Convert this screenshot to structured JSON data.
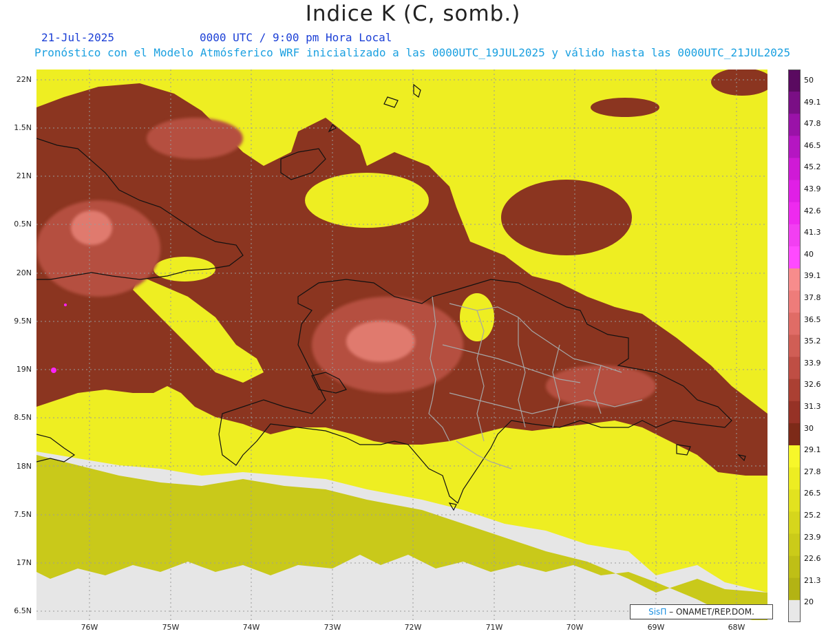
{
  "title": "Indice K (C, somb.)",
  "date": "21-Jul-2025",
  "time": "0000 UTC / 9:00 pm Hora Local",
  "description": "Pronóstico con el Modelo Atmósferico WRF inicializado a las 0000UTC_19JUL2025 y válido hasta las  0000UTC_21JUL2025",
  "lat_labels": [
    "22N",
    "1.5N",
    "21N",
    "0.5N",
    "20N",
    "9.5N",
    "19N",
    "8.5N",
    "18N",
    "7.5N",
    "17N",
    "6.5N"
  ],
  "lon_labels": [
    "76W",
    "75W",
    "74W",
    "73W",
    "72W",
    "71W",
    "70W",
    "69W",
    "68W"
  ],
  "colorbar": {
    "labels": [
      "50",
      "49.1",
      "47.8",
      "46.5",
      "45.2",
      "43.9",
      "42.6",
      "41.3",
      "40",
      "39.1",
      "37.8",
      "36.5",
      "35.2",
      "33.9",
      "32.6",
      "31.3",
      "30",
      "29.1",
      "27.8",
      "26.5",
      "25.2",
      "23.9",
      "22.6",
      "21.3",
      "20"
    ],
    "colors": [
      "#5a0a60",
      "#7a0f85",
      "#9a12a8",
      "#b516c2",
      "#cf1ad6",
      "#e01fe6",
      "#ee2aef",
      "#f23ff2",
      "#ff4aff",
      "#f78c8c",
      "#ee7c7a",
      "#e06c66",
      "#d05e55",
      "#bf4e44",
      "#ab4033",
      "#963226",
      "#7d2a18",
      "#f7f72a",
      "#eded22",
      "#e2e21f",
      "#d6d61c",
      "#cbcb19",
      "#bfbf16",
      "#b3b314",
      "#e8e8e8"
    ],
    "ticks": [
      "30",
      "20"
    ]
  },
  "map_colors": {
    "no_data": "#e6e6e6",
    "low": "#c9c91a",
    "mid": "#eeee22",
    "high_bright": "#f5f52a",
    "k_dark": "#8b3520",
    "k_mid": "#b5503f",
    "k_pink": "#e07a6e",
    "magenta": "#ff20ff",
    "grid": "#9a9a9a",
    "coast": "#111111",
    "borders": "#a6a6a6"
  },
  "credit": {
    "sis": "SisΠ",
    "org": "– ONAMET/REP.DOM."
  }
}
